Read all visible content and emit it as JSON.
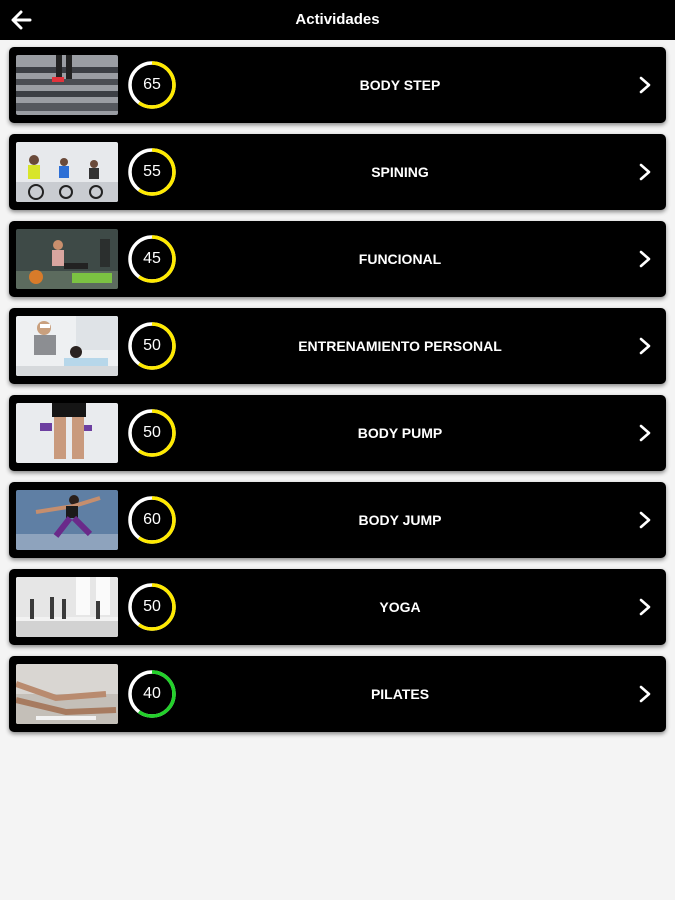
{
  "header": {
    "title": "Actividades",
    "back_icon": "arrow-left-icon"
  },
  "colors": {
    "ring_yellow": "#ffea00",
    "ring_green": "#22d12a",
    "ring_track": "#ffffff"
  },
  "activities": [
    {
      "name": "BODY STEP",
      "value": "65",
      "ring_color": "#ffea00",
      "ring_fraction": 0.6,
      "image": "step-class-photo"
    },
    {
      "name": "SPINING",
      "value": "55",
      "ring_color": "#ffea00",
      "ring_fraction": 0.6,
      "image": "spinning-class-photo"
    },
    {
      "name": "FUNCIONAL",
      "value": "45",
      "ring_color": "#ffea00",
      "ring_fraction": 0.6,
      "image": "functional-training-photo"
    },
    {
      "name": "ENTRENAMIENTO PERSONAL",
      "value": "50",
      "ring_color": "#ffea00",
      "ring_fraction": 0.6,
      "image": "personal-training-photo"
    },
    {
      "name": "BODY PUMP",
      "value": "50",
      "ring_color": "#ffea00",
      "ring_fraction": 0.6,
      "image": "body-pump-photo"
    },
    {
      "name": "BODY JUMP",
      "value": "60",
      "ring_color": "#ffea00",
      "ring_fraction": 0.6,
      "image": "body-jump-photo"
    },
    {
      "name": "YOGA",
      "value": "50",
      "ring_color": "#ffea00",
      "ring_fraction": 0.6,
      "image": "yoga-class-photo"
    },
    {
      "name": "PILATES",
      "value": "40",
      "ring_color": "#22d12a",
      "ring_fraction": 0.6,
      "image": "pilates-class-photo"
    }
  ]
}
